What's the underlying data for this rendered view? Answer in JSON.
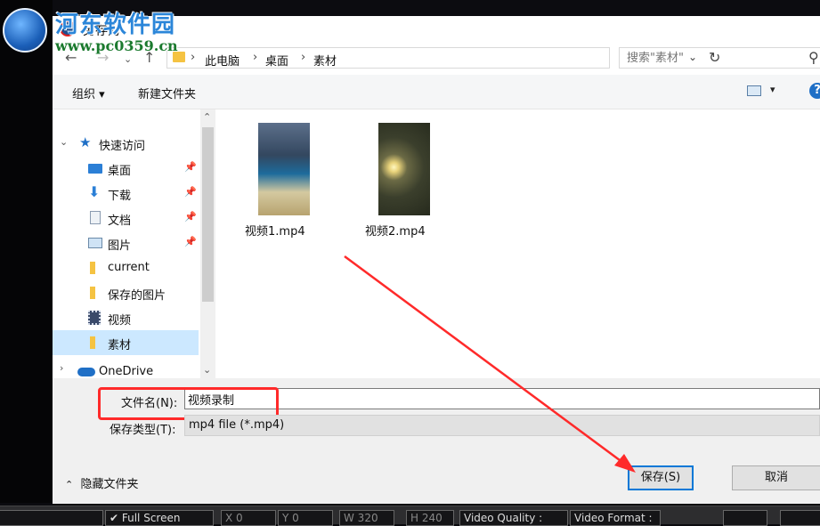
{
  "watermark": {
    "title": "河东软件园",
    "url": "www.pc0359.cn"
  },
  "dialog": {
    "title": "另存为"
  },
  "address": {
    "crumbs": [
      "此电脑",
      "桌面",
      "素材"
    ],
    "search_placeholder": "搜索\"素材\""
  },
  "toolbar": {
    "organize": "组织 ▾",
    "new_folder": "新建文件夹",
    "help": "?"
  },
  "nav": {
    "quick_access": "快速访问",
    "items": [
      {
        "label": "桌面",
        "icon": "desktop-icon",
        "pinned": true
      },
      {
        "label": "下载",
        "icon": "download-icon",
        "pinned": true
      },
      {
        "label": "文档",
        "icon": "document-icon",
        "pinned": true
      },
      {
        "label": "图片",
        "icon": "picture-icon",
        "pinned": true
      },
      {
        "label": "current",
        "icon": "folder-icon",
        "pinned": false
      },
      {
        "label": "保存的图片",
        "icon": "folder-icon",
        "pinned": false
      },
      {
        "label": "视频",
        "icon": "video-icon",
        "pinned": false
      },
      {
        "label": "素材",
        "icon": "folder-icon",
        "pinned": false,
        "selected": true
      }
    ],
    "onedrive": "OneDrive"
  },
  "files": [
    {
      "name": "视频1.mp4"
    },
    {
      "name": "视频2.mp4"
    }
  ],
  "form": {
    "filename_label": "文件名(N):",
    "filename_value": "视频录制",
    "type_label": "保存类型(T):",
    "type_value": "mp4 file (*.mp4)",
    "hide_folders": "隐藏文件夹",
    "save": "保存(S)",
    "cancel": "取消"
  },
  "bottom_bar": {
    "full_screen": "Full Screen",
    "x": "X 0",
    "y": "Y 0",
    "w": "W 320",
    "h": "H 240",
    "video_quality": "Video Quality : ",
    "video_format": "Video Format : "
  },
  "colors": {
    "annotation_red": "#ff2a2a",
    "accent_blue": "#0078d7",
    "selection": "#cce8ff"
  }
}
